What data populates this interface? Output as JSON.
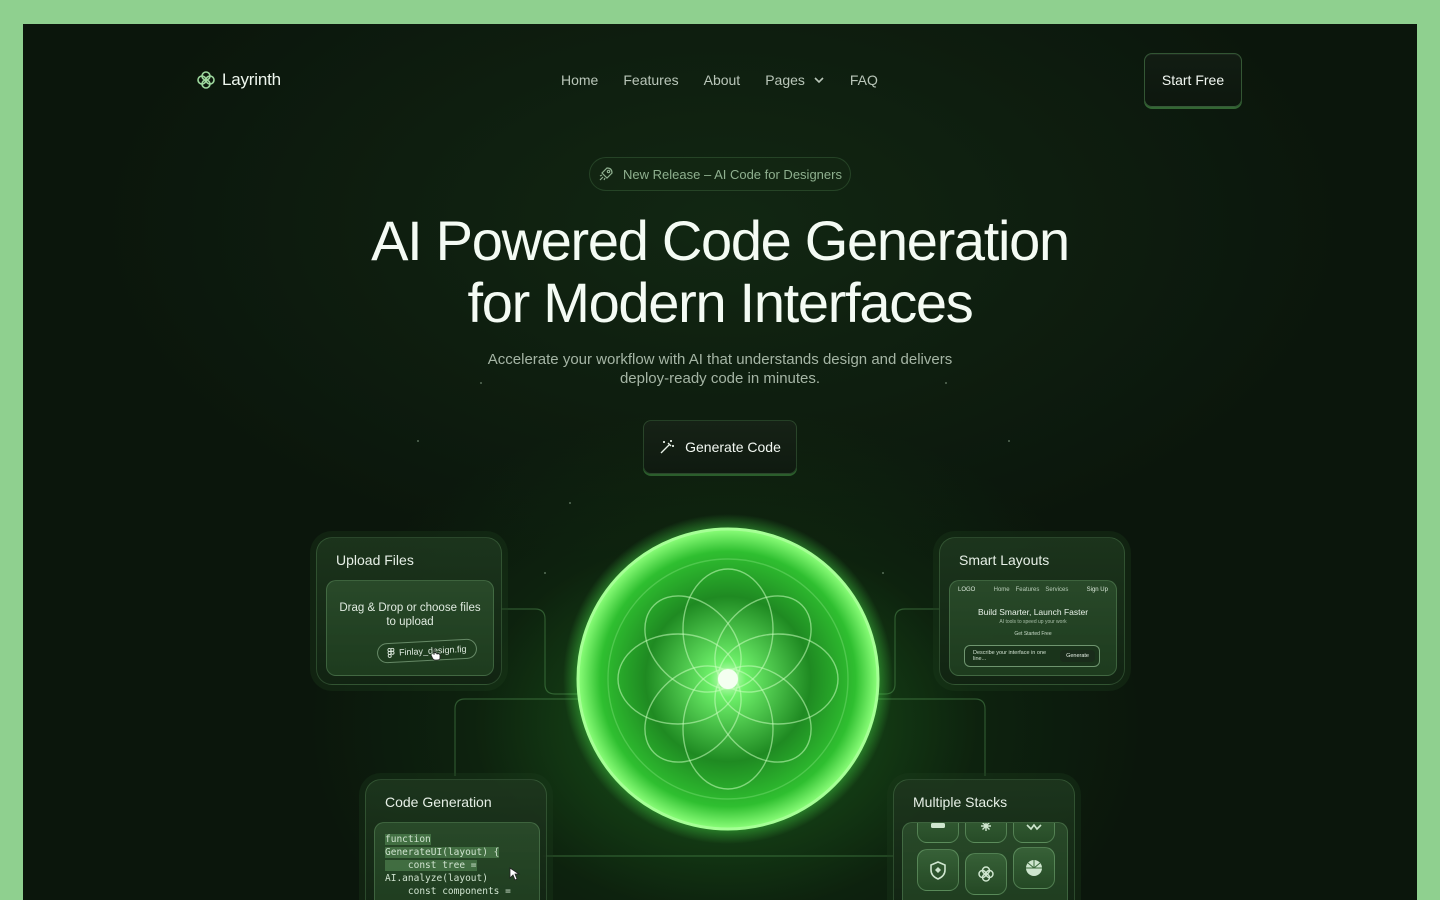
{
  "brand": {
    "name": "Layrinth"
  },
  "nav": {
    "items": [
      {
        "label": "Home"
      },
      {
        "label": "Features"
      },
      {
        "label": "About"
      },
      {
        "label": "Pages",
        "has_dropdown": true
      },
      {
        "label": "FAQ"
      }
    ],
    "cta_label": "Start Free"
  },
  "hero": {
    "badge": "New Release – AI Code for Designers",
    "headline_line1": "AI Powered Code Generation",
    "headline_line2": "for Modern Interfaces",
    "sub_line1": "Accelerate your workflow with AI that understands design and delivers",
    "sub_line2": "deploy-ready code in minutes.",
    "button_label": "Generate Code"
  },
  "cards": {
    "upload": {
      "title": "Upload Files",
      "drop_text_line1": "Drag & Drop or choose files",
      "drop_text_line2": "to upload",
      "file_name": "Finlay_design.fig"
    },
    "layouts": {
      "title": "Smart Layouts",
      "mini_logo": "LOGO",
      "mini_links": [
        "Home",
        "Features",
        "Services"
      ],
      "mini_signup": "Sign Up",
      "mini_headline": "Build Smarter, Launch Faster",
      "mini_sub": "AI tools to speed up your work",
      "mini_cta": "Get Started Free",
      "mini_input_placeholder": "Describe your interface in one line...",
      "mini_generate": "Generate"
    },
    "code": {
      "title": "Code Generation",
      "lines": [
        "function",
        "GenerateUI(layout) {",
        "    const tree =",
        "AI.analyze(layout)",
        "    const components ="
      ]
    },
    "stacks": {
      "title": "Multiple Stacks"
    }
  },
  "colors": {
    "background": "#0b160c",
    "accent": "#3ddc3d",
    "frame": "#8fd08f"
  }
}
